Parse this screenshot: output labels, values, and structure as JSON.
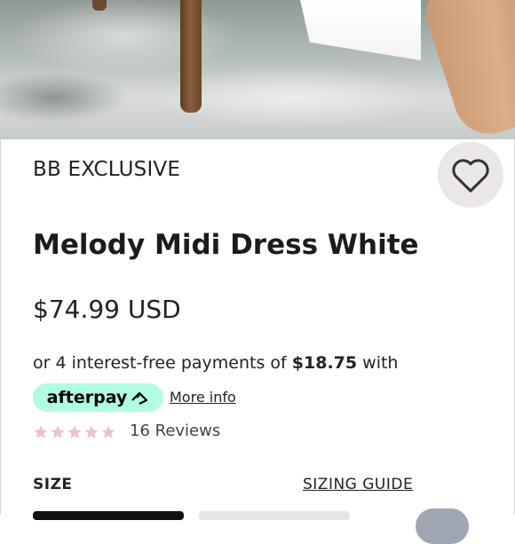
{
  "product": {
    "brand": "BB EXCLUSIVE",
    "title": "Melody Midi Dress White",
    "price": "$74.99 USD"
  },
  "payments": {
    "prefix": "or 4 interest-free payments of ",
    "amount": "$18.75",
    "suffix": " with",
    "provider_label": "afterpay",
    "more_info": "More info",
    "badge_color": "#b2fce4"
  },
  "rating": {
    "stars": 5,
    "star_color": "#f0bfcf",
    "reviews_text": "16 Reviews"
  },
  "size": {
    "label": "SIZE",
    "guide": "SIZING GUIDE"
  },
  "wishlist": {
    "icon": "heart-icon"
  }
}
